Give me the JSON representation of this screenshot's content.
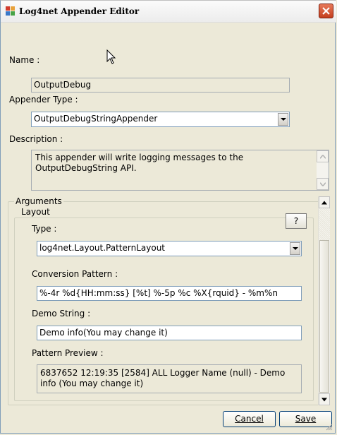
{
  "window": {
    "title": "Log4net Appender Editor",
    "close_icon": "close-icon",
    "app_icon": "log4net-app-icon"
  },
  "name": {
    "label": "Name :",
    "value": "OutputDebug"
  },
  "appender_type": {
    "label": "Appender Type :",
    "value": "OutputDebugStringAppender"
  },
  "description": {
    "label": "Description :",
    "text": "This appender will write logging messages to the OutputDebugString API."
  },
  "arguments": {
    "label": "Arguments",
    "layout": {
      "label": "Layout",
      "help_label": "?",
      "type_label": "Type :",
      "type_value": "log4net.Layout.PatternLayout",
      "conversion_pattern_label": "Conversion Pattern :",
      "conversion_pattern_value": "%-4r %d{HH:mm:ss} [%t] %-5p %c %X{rquid} - %m%n",
      "demo_string_label": "Demo String :",
      "demo_string_value": "Demo info(You may change it)",
      "pattern_preview_label": "Pattern Preview :",
      "pattern_preview_value": "6837652 12:19:35 [2584] ALL   Logger Name (null) - Demo info (You may change it)"
    }
  },
  "buttons": {
    "cancel": "Cancel",
    "save": "Save"
  }
}
